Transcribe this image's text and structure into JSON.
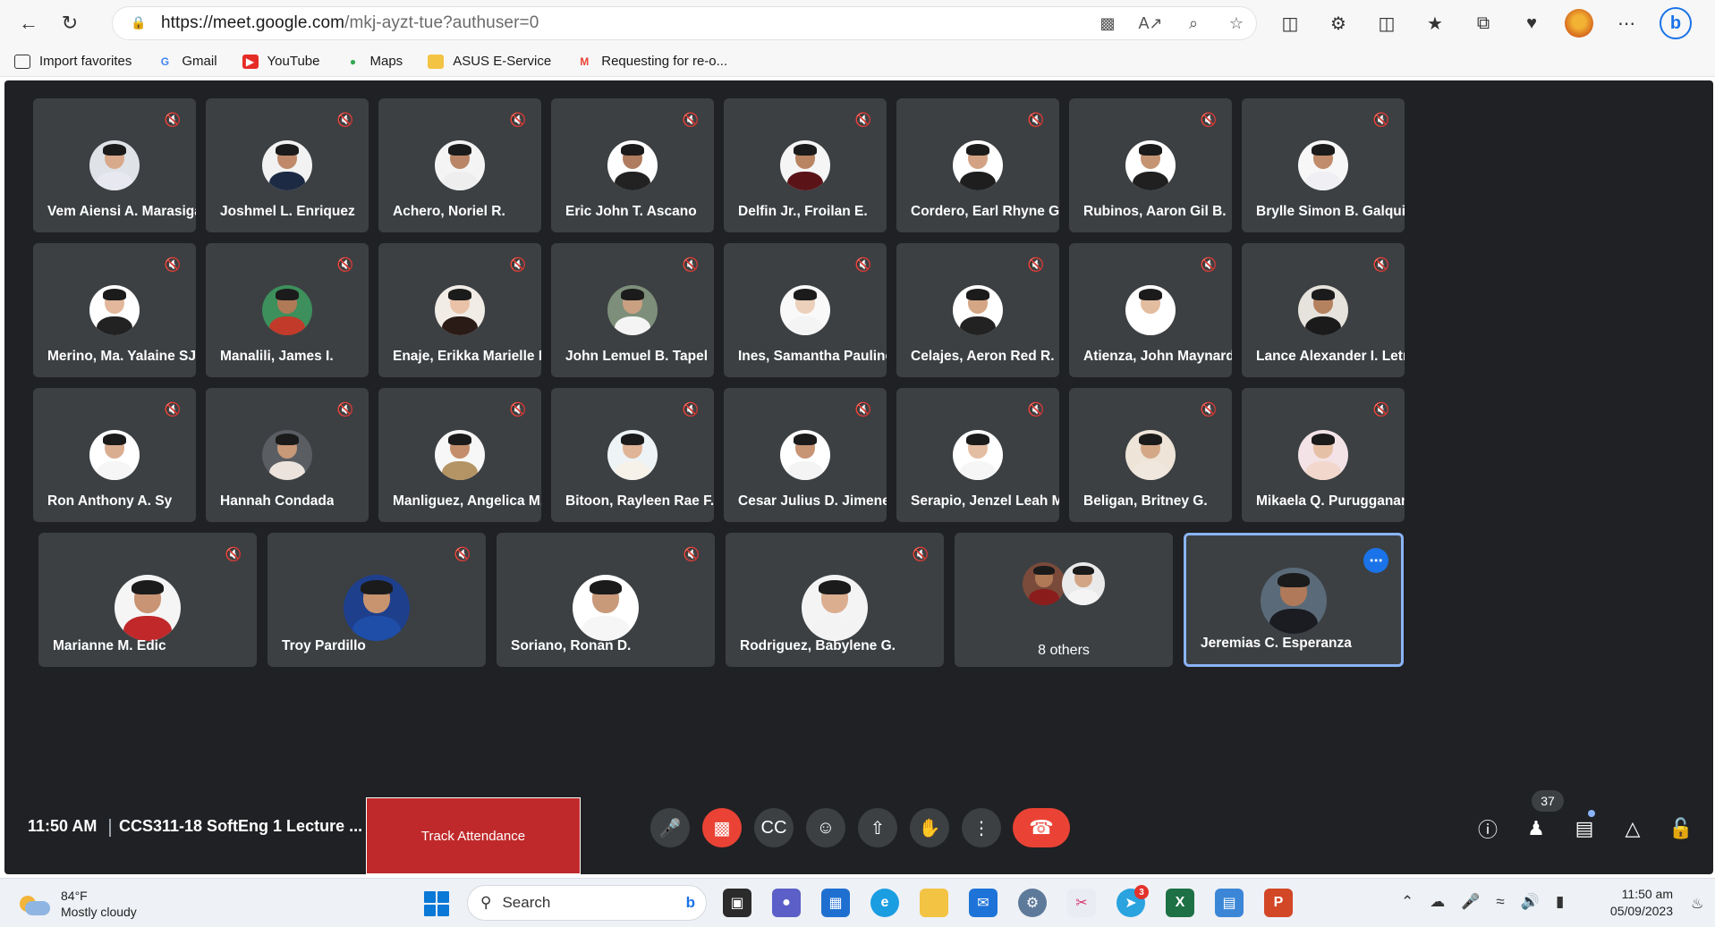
{
  "browser": {
    "url_main": "https://meet.google.com",
    "url_rest": "/mkj-ayzt-tue?authuser=0",
    "favorites": [
      {
        "label": "Import favorites",
        "icon": "import-icon"
      },
      {
        "label": "Gmail",
        "icon": "google-icon"
      },
      {
        "label": "YouTube",
        "icon": "youtube-icon"
      },
      {
        "label": "Maps",
        "icon": "maps-pin-icon"
      },
      {
        "label": "ASUS E-Service",
        "icon": "folder-icon"
      },
      {
        "label": "Requesting for re-o...",
        "icon": "gmail-icon"
      }
    ]
  },
  "participants": [
    {
      "name": "Vem Aiensi A. Marasigan",
      "skin": "#d9a98c",
      "shirt": "#e8e8f0",
      "bg": "#dfe3e8"
    },
    {
      "name": "Joshmel L. Enriquez",
      "skin": "#c08a6a",
      "shirt": "#1c2a44",
      "bg": "#f2f2f2"
    },
    {
      "name": "Achero, Noriel R.",
      "skin": "#b98566",
      "shirt": "#eeeeee",
      "bg": "#f4f4f4"
    },
    {
      "name": "Eric John T. Ascano",
      "skin": "#b07c5f",
      "shirt": "#222222",
      "bg": "#ffffff"
    },
    {
      "name": "Delfin Jr., Froilan E.",
      "skin": "#b88462",
      "shirt": "#5a1418",
      "bg": "#f5f5f5"
    },
    {
      "name": "Cordero, Earl Rhyne G.",
      "skin": "#d3a284",
      "shirt": "#1e1e1e",
      "bg": "#ffffff"
    },
    {
      "name": "Rubinos, Aaron Gil B.",
      "skin": "#c59473",
      "shirt": "#202020",
      "bg": "#ffffff"
    },
    {
      "name": "Brylle Simon B. Galquie...",
      "skin": "#c08c6b",
      "shirt": "#f0f0f4",
      "bg": "#f7f7f7"
    },
    {
      "name": "Merino, Ma. Yalaine SJ.",
      "skin": "#e2b79c",
      "shirt": "#222222",
      "bg": "#ffffff"
    },
    {
      "name": "Manalili, James I.",
      "skin": "#b07a57",
      "shirt": "#c23a2a",
      "bg": "#3d8f5c"
    },
    {
      "name": "Enaje, Erikka Marielle M.",
      "skin": "#e9c2a7",
      "shirt": "#2b1b16",
      "bg": "#f2ece6"
    },
    {
      "name": "John Lemuel B. Tapel",
      "skin": "#caa082",
      "shirt": "#f4f4f4",
      "bg": "#7d8f7a"
    },
    {
      "name": "Ines, Samantha Pauline...",
      "skin": "#ecd0bb",
      "shirt": "#f4f4f4",
      "bg": "#f9f9f9"
    },
    {
      "name": "Celajes, Aeron Red R.",
      "skin": "#d4a686",
      "shirt": "#222222",
      "bg": "#ffffff"
    },
    {
      "name": "Atienza, John Maynard...",
      "skin": "#e3bda0",
      "shirt": "#ffffff",
      "bg": "#ffffff"
    },
    {
      "name": "Lance Alexander I. Letr...",
      "skin": "#b5825f",
      "shirt": "#1b1b1b",
      "bg": "#e6e2dc"
    },
    {
      "name": "Ron Anthony A. Sy",
      "skin": "#d9ad90",
      "shirt": "#f6f6f6",
      "bg": "#ffffff"
    },
    {
      "name": "Hannah Condada",
      "skin": "#c89979",
      "shirt": "#ece4dc",
      "bg": "#5a5e63"
    },
    {
      "name": "Manliguez, Angelica M...",
      "skin": "#c48e6c",
      "shirt": "#b49464",
      "bg": "#f7f7f7"
    },
    {
      "name": "Bitoon, Rayleen Rae F.",
      "skin": "#dfb497",
      "shirt": "#f6f2ea",
      "bg": "#eef3f5"
    },
    {
      "name": "Cesar Julius D. Jimenez",
      "skin": "#c79474",
      "shirt": "#f4f4f4",
      "bg": "#ffffff"
    },
    {
      "name": "Serapio, Jenzel Leah M.",
      "skin": "#e4bea2",
      "shirt": "#f6f6f6",
      "bg": "#ffffff"
    },
    {
      "name": "Beligan, Britney G.",
      "skin": "#d4a887",
      "shirt": "#f0e8de",
      "bg": "#eee4d8"
    },
    {
      "name": "Mikaela Q. Purugganan",
      "skin": "#e6c0a6",
      "shirt": "#f2d8cc",
      "bg": "#f3e2e6"
    },
    {
      "name": "Marianne M. Edic",
      "skin": "#c99474",
      "shirt": "#c0282a",
      "bg": "#f5f5f5"
    },
    {
      "name": "Troy Pardillo",
      "skin": "#c8936f",
      "shirt": "#1e4ea8",
      "bg": "#1e3f8c"
    },
    {
      "name": "Soriano, Ronan D.",
      "skin": "#c99a7a",
      "shirt": "#f6f6f6",
      "bg": "#ffffff"
    },
    {
      "name": "Rodriguez, Babylene G.",
      "skin": "#dcae90",
      "shirt": "#f3f3f3",
      "bg": "#f4f4f4"
    }
  ],
  "others_tile": {
    "label": "8 others"
  },
  "active_speaker": {
    "name": "Jeremias C. Esperanza",
    "skin": "#b07a5a",
    "shirt": "#1b1b22",
    "bg": "#5a6a78"
  },
  "controls": {
    "time": "11:50 AM",
    "meeting_title": "CCS311-18 SoftEng 1 Lecture ...",
    "track_attendance": "Track Attendance",
    "participant_count": "37"
  },
  "taskbar": {
    "temperature": "84°F",
    "weather": "Mostly cloudy",
    "search_placeholder": "Search",
    "telegram_badge": "3",
    "time": "11:50 am",
    "date": "05/09/2023"
  }
}
